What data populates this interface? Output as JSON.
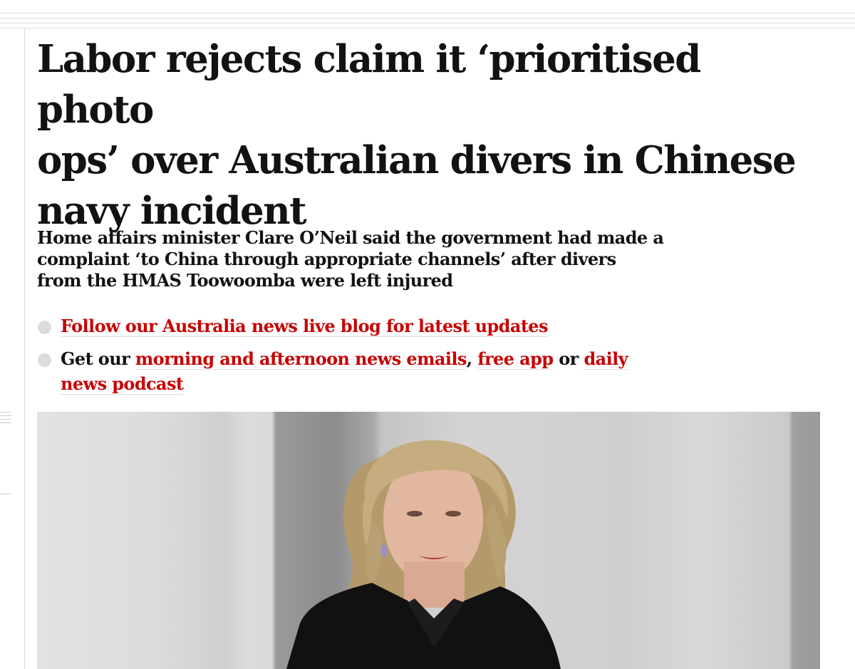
{
  "article": {
    "headline_line1": "Labor rejects claim it ‘prioritised photo",
    "headline_line2": "ops’ over Australian divers in Chinese",
    "headline_line3": "navy incident",
    "standfirst_line1": "Home affairs minister Clare O’Neil said the government had made a",
    "standfirst_line2": "complaint ‘to China through appropriate channels’ after divers",
    "standfirst_line3": "from the HMAS Toowoomba were left injured",
    "bullets": [
      {
        "link_text": "Follow our Australia news live blog for latest updates"
      },
      {
        "prefix": "Get our ",
        "link1": "morning and afternoon news emails",
        "sep1": ", ",
        "link2": "free app",
        "sep2": " or ",
        "link3a": "daily",
        "link3b": "news podcast"
      }
    ]
  },
  "colors": {
    "link": "#c70000",
    "text": "#121212",
    "bullet": "#dcdcdc"
  },
  "image": {
    "icon": "photo-of-woman-in-black-jacket"
  }
}
